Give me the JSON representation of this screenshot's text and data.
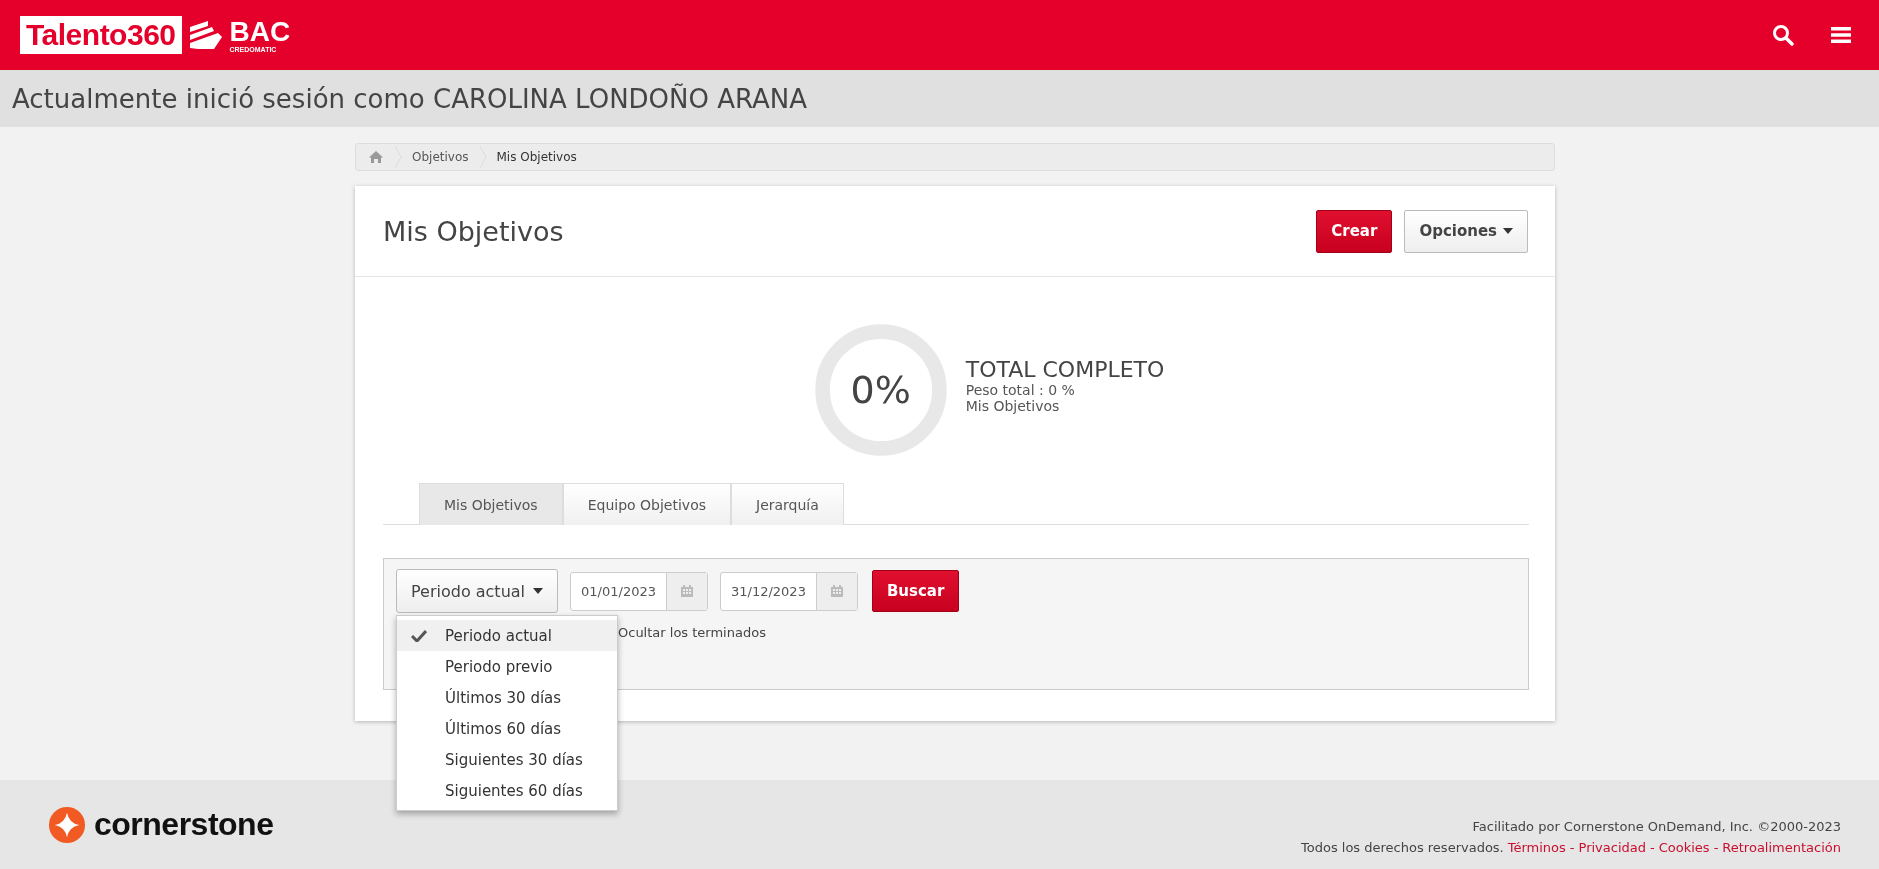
{
  "header": {
    "logo_text": "Talento360",
    "brand": "BAC",
    "brand_sub": "CREDOMATIC"
  },
  "session": {
    "text": "Actualmente inició sesión como CAROLINA LONDOÑO ARANA"
  },
  "breadcrumb": [
    "Objetivos",
    "Mis Objetivos"
  ],
  "card": {
    "title": "Mis Objetivos",
    "buttons": [
      {
        "label": "Crear",
        "kind": "primary"
      },
      {
        "label": "Opciones",
        "kind": "dropdown"
      }
    ]
  },
  "progress": {
    "reading": "0%",
    "level": 0,
    "title": "TOTAL COMPLETO",
    "weight": "Peso total : 0 %",
    "subtitle": "Mis Objetivos"
  },
  "tabs": [
    {
      "label": "Mis Objetivos",
      "selected": true
    },
    {
      "label": "Equipo Objetivos",
      "selected": false
    },
    {
      "label": "Jerarquía",
      "selected": false
    }
  ],
  "filters": {
    "period": "Periodo actual",
    "start_date": "01/01/2023",
    "end_date": "31/12/2023",
    "search_button": "Buscar",
    "hide_finished": "Ocultar los terminados"
  },
  "period_menu": [
    {
      "label": "Periodo actual",
      "selected": true
    },
    {
      "label": "Periodo previo",
      "selected": false
    },
    {
      "label": "Últimos 30 días",
      "selected": false
    },
    {
      "label": "Últimos 60 días",
      "selected": false
    },
    {
      "label": "Siguientes 30 días",
      "selected": false
    },
    {
      "label": "Siguientes 60 días",
      "selected": false
    }
  ],
  "footer": {
    "brand": "cornerstone",
    "powered": "Facilitado por Cornerstone OnDemand, Inc. ©2000-2023",
    "rights": "Todos los derechos reservados.",
    "separator": "-",
    "links": [
      "Términos",
      "Privacidad",
      "Cookies",
      "Retroalimentación"
    ]
  }
}
